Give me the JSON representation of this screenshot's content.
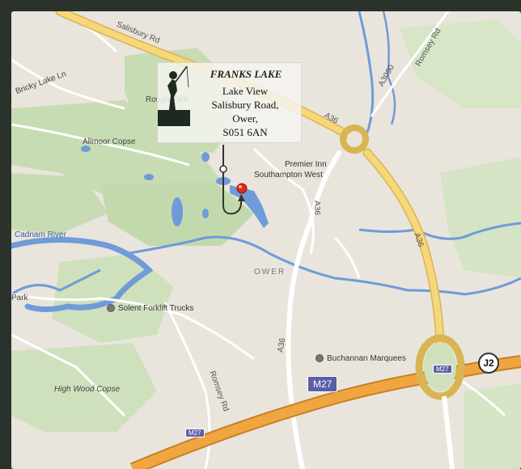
{
  "infobox": {
    "title": "FRANKS LAKE",
    "lines": [
      "Lake View",
      "Salisbury Road,",
      "Ower,",
      "S051 6AN"
    ]
  },
  "map": {
    "places": {
      "rough_park": "Rough Park",
      "allmoor_copse": "Allmoor Copse",
      "bricky_lake_ln": "Bricky Lake Ln",
      "cadnam_river": "Cadnam River",
      "park": "Park",
      "ower": "OWER",
      "high_wood_copse": "High Wood Copse"
    },
    "roads": {
      "salisbury_rd": "Salisbury Rd",
      "a36_top": "A36",
      "a36_right": "A36",
      "a36_mid": "A36",
      "a36_low": "A36",
      "a3090": "A3090",
      "romsey_rd_top": "Romsey Rd",
      "romsey_rd_bottom": "Romsey Rd"
    },
    "pois": {
      "premier_inn_1": "Premier Inn",
      "premier_inn_2": "Southampton West",
      "solent_forklift": "Solent Forklift Trucks",
      "buchannan": "Buchannan Marquees"
    },
    "shields": {
      "m27_main": "M27",
      "m27_small_bottom": "M27",
      "m27_small_junction": "M27"
    },
    "junction": "J2",
    "colors": {
      "land": "#e9e5dc",
      "wood": "#c7dcb3",
      "water": "#6f9bd9",
      "motorway": "#f0a640",
      "a_road": "#f6d77a",
      "minor_road": "#ffffff"
    }
  }
}
